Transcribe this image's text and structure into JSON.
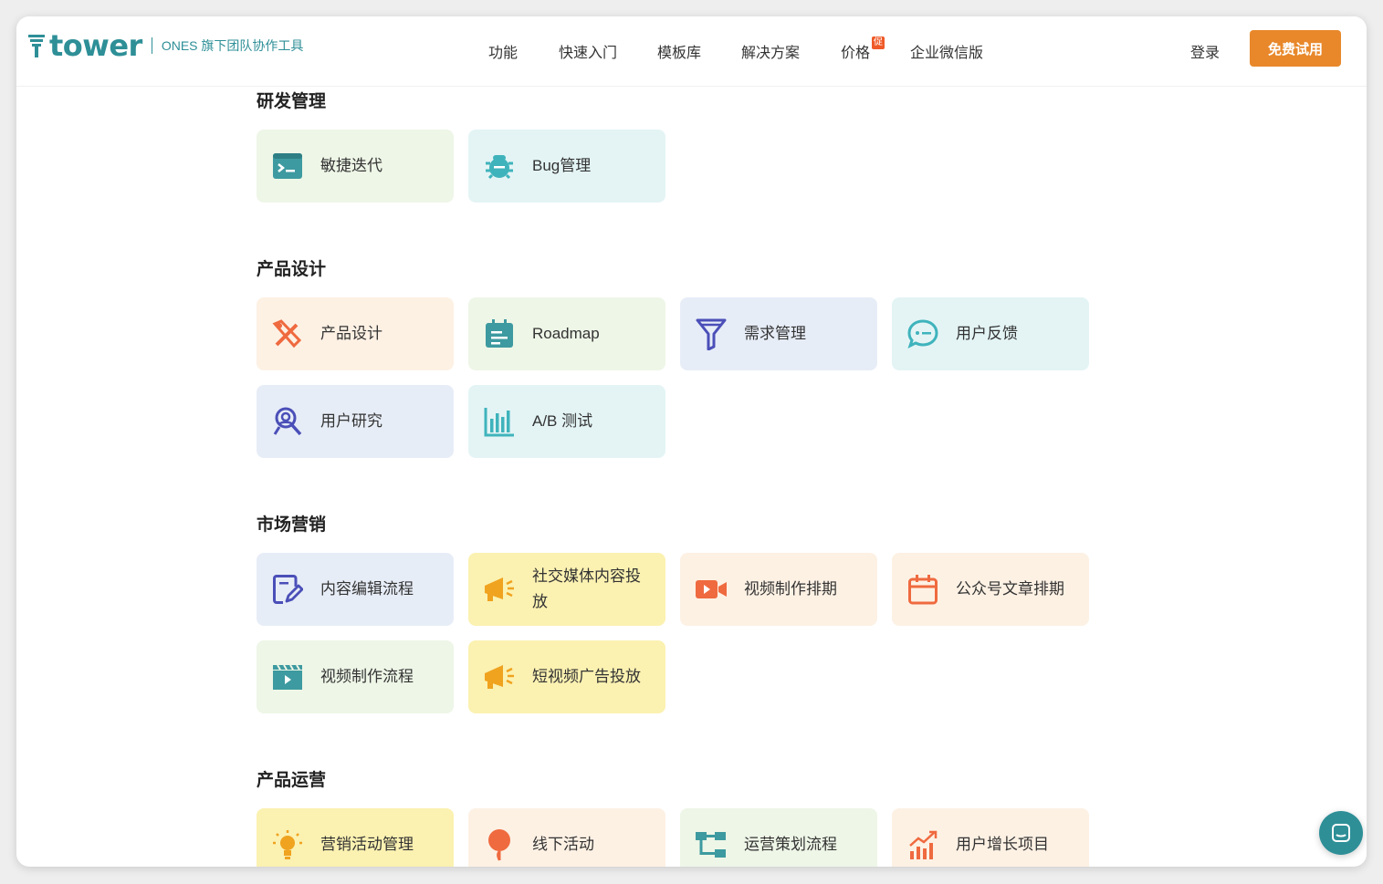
{
  "header": {
    "logo_text": "tower",
    "logo_sub": "ONES 旗下团队协作工具",
    "nav": [
      "功能",
      "快速入门",
      "模板库",
      "解决方案",
      "价格",
      "企业微信版"
    ],
    "price_badge": "促",
    "login": "登录",
    "trial": "免费试用"
  },
  "sections": [
    {
      "title": "研发管理",
      "cards": [
        {
          "label": "敏捷迭代",
          "icon": "terminal-icon",
          "color": "#3d9aa0"
        },
        {
          "label": "Bug管理",
          "icon": "bug-icon",
          "color": "#3fb3bc"
        }
      ]
    },
    {
      "title": "产品设计",
      "cards": [
        {
          "label": "产品设计",
          "icon": "design-tools-icon",
          "color": "#ef6a3f"
        },
        {
          "label": "Roadmap",
          "icon": "calendar-list-icon",
          "color": "#3d9aa0"
        },
        {
          "label": "需求管理",
          "icon": "funnel-icon",
          "color": "#4b4fb8"
        },
        {
          "label": "用户反馈",
          "icon": "chat-bubble-icon",
          "color": "#3fb3bc"
        },
        {
          "label": "用户研究",
          "icon": "user-search-icon",
          "color": "#4b4fb8"
        },
        {
          "label": "A/B 测试",
          "icon": "bar-chart-icon",
          "color": "#3fb3bc"
        }
      ]
    },
    {
      "title": "市场营销",
      "cards": [
        {
          "label": "内容编辑流程",
          "icon": "edit-doc-icon",
          "color": "#4b4fb8"
        },
        {
          "label": "社交媒体内容投放",
          "icon": "megaphone-icon",
          "color": "#f0a31f"
        },
        {
          "label": "视频制作排期",
          "icon": "video-camera-icon",
          "color": "#ef6a3f"
        },
        {
          "label": "公众号文章排期",
          "icon": "calendar-icon",
          "color": "#ef6a3f"
        },
        {
          "label": "视频制作流程",
          "icon": "clapperboard-icon",
          "color": "#3d9aa0"
        },
        {
          "label": "短视频广告投放",
          "icon": "megaphone-icon",
          "color": "#f0a31f"
        }
      ]
    },
    {
      "title": "产品运营",
      "cards": [
        {
          "label": "营销活动管理",
          "icon": "lightbulb-icon",
          "color": "#f0a31f"
        },
        {
          "label": "线下活动",
          "icon": "map-pin-icon",
          "color": "#ef6a3f"
        },
        {
          "label": "运营策划流程",
          "icon": "flow-tree-icon",
          "color": "#3d9aa0"
        },
        {
          "label": "用户增长项目",
          "icon": "growth-chart-icon",
          "color": "#ef6a3f"
        }
      ]
    }
  ],
  "chat_icon": "chat-widget-icon"
}
